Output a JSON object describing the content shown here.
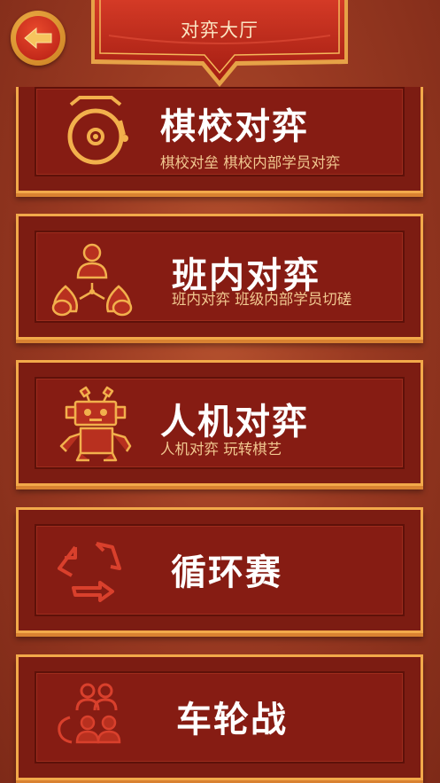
{
  "header": {
    "title": "对弈大厅"
  },
  "colors": {
    "accent": "#f2a94a",
    "panel": "#861c13",
    "text": "#ffffff",
    "subtext": "#f1c890"
  },
  "modes": [
    {
      "title": "棋校对弈",
      "subtitle": "棋校对垒  棋校内部学员对弈",
      "icon": "gong-icon"
    },
    {
      "title": "班内对弈",
      "subtitle": "班内对弈 班级内部学员切磋",
      "icon": "group-icon"
    },
    {
      "title": "人机对弈",
      "subtitle": "人机对弈 玩转棋艺",
      "icon": "robot-icon"
    },
    {
      "title": "循环赛",
      "subtitle": "",
      "icon": "cycle-icon"
    },
    {
      "title": "车轮战",
      "subtitle": "",
      "icon": "team-icon"
    }
  ]
}
